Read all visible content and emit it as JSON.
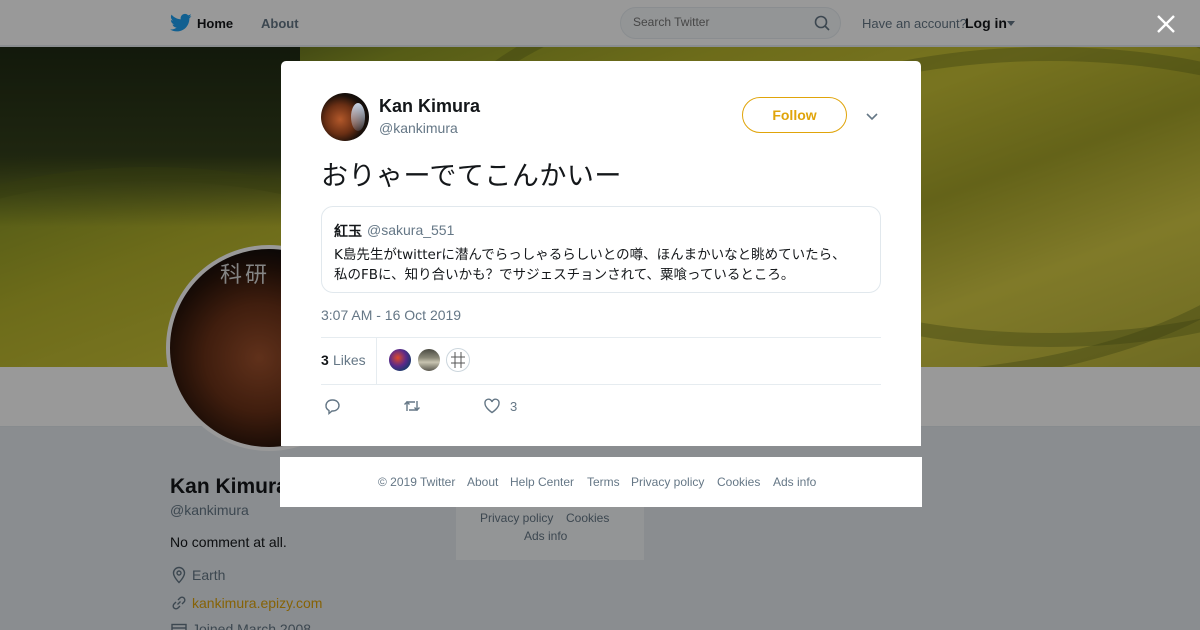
{
  "topbar": {
    "home": "Home",
    "about": "About",
    "search_placeholder": "Search Twitter",
    "have_account": "Have an account?",
    "login": "Log in"
  },
  "profile": {
    "name": "Kan Kimura",
    "handle": "@kankimura",
    "bio": "No comment at all.",
    "location": "Earth",
    "website": "kankimura.epizy.com",
    "joined": "Joined March 2008",
    "avatar_text": "科研"
  },
  "background_footer": {
    "privacy": "Privacy policy",
    "cookies": "Cookies",
    "ads_info": "Ads info"
  },
  "tweet": {
    "author_name": "Kan Kimura",
    "author_handle": "@kankimura",
    "follow_label": "Follow",
    "text": "おりゃーでてこんかいー",
    "quoted": {
      "name": "紅玉",
      "handle": "@sakura_551",
      "line1": "K島先生がtwitterに潜んでらっしゃるらしいとの噂、ほんまかいなと眺めていたら、",
      "line2": "私のFBに、知り合いかも？でサジェスチョンされて、粟喰っているところ。"
    },
    "timestamp": "3:07 AM - 16 Oct 2019",
    "likes_count": "3",
    "likes_label": "Likes",
    "like_action_count": "3"
  },
  "modal_footer": {
    "copyright": "© 2019 Twitter",
    "about": "About",
    "help": "Help Center",
    "terms": "Terms",
    "privacy": "Privacy policy",
    "cookies": "Cookies",
    "ads": "Ads info"
  },
  "colors": {
    "accent": "#e0a40a",
    "twitter_blue": "#1da1f2",
    "muted": "#657786",
    "overlay": "rgba(0,0,0,0.40)"
  }
}
